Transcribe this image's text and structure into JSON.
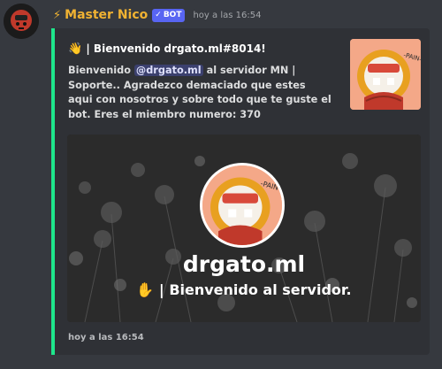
{
  "message": {
    "author": "Master Nico",
    "bot_tag": "BOT",
    "timestamp": "hoy a las 16:54"
  },
  "embed": {
    "accent_color": "#1ee68c",
    "title": "| Bienvenido drgato.ml#8014!",
    "desc_pre": "Bienvenido ",
    "mention": "@drgato.ml",
    "desc_post": " al servidor MN | Soporte.. Agradezco demaciado que estes aqui con nosotros y sobre todo que te guste el bot. Eres el miembro numero: 370",
    "banner": {
      "username": "drgato.ml",
      "subtitle": "| Bienvenido al servidor."
    },
    "footer": "hoy a las 16:54"
  },
  "icons": [
    "bolt-icon",
    "check-icon",
    "wave-icon",
    "hand-icon"
  ]
}
